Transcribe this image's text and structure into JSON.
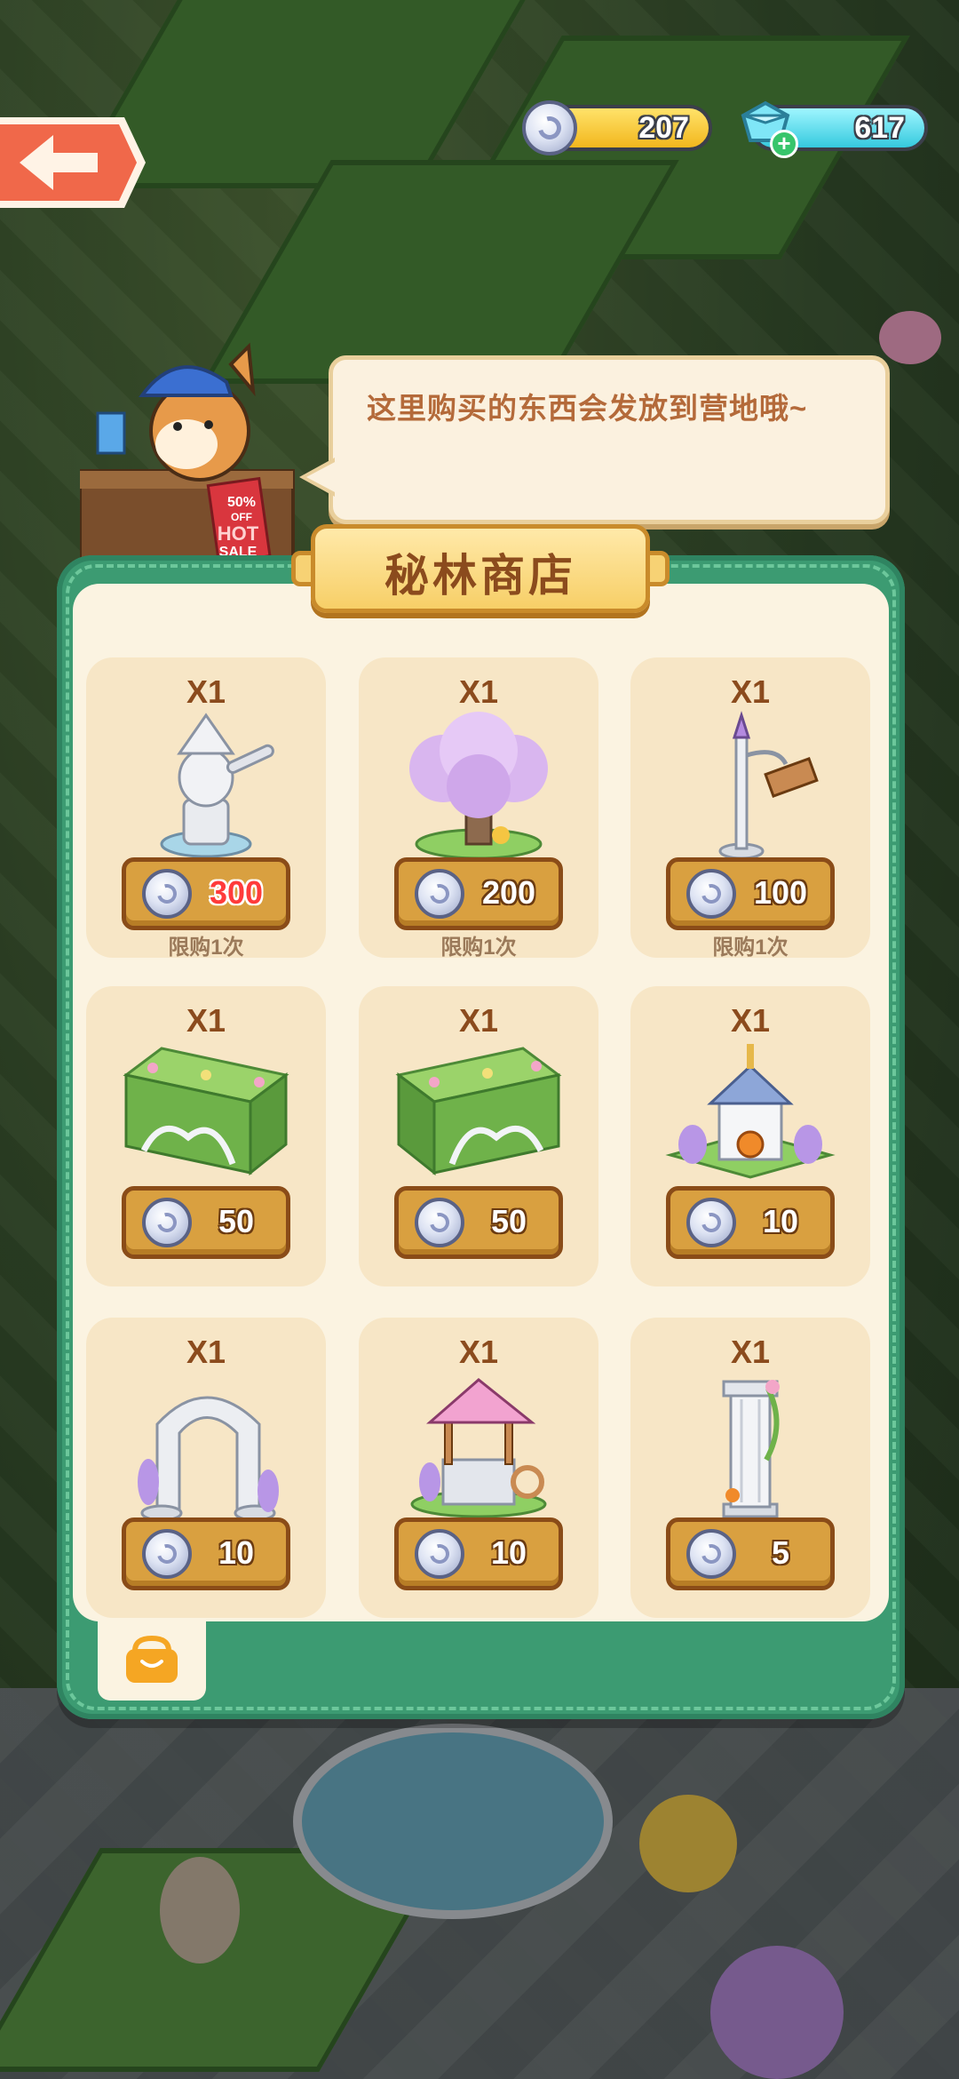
{
  "header": {
    "coins": "207",
    "gems": "617"
  },
  "npc": {
    "speech": "这里购买的东西会发放到营地哦~",
    "sign": {
      "discount": "50%",
      "off": "OFF",
      "hot": "HOT",
      "sale": "SALE"
    }
  },
  "shop": {
    "title": "秘林商店",
    "items": [
      {
        "qty": "X1",
        "price": "300",
        "limit": "限购1次",
        "icon": "statue-icon"
      },
      {
        "qty": "X1",
        "price": "200",
        "limit": "限购1次",
        "icon": "blossom-tree-icon"
      },
      {
        "qty": "X1",
        "price": "100",
        "limit": "限购1次",
        "icon": "signpost-lamp-icon"
      },
      {
        "qty": "X1",
        "price": "50",
        "limit": "",
        "icon": "hedge-fence-left-icon"
      },
      {
        "qty": "X1",
        "price": "50",
        "limit": "",
        "icon": "hedge-fence-right-icon"
      },
      {
        "qty": "X1",
        "price": "10",
        "limit": "",
        "icon": "gazebo-icon"
      },
      {
        "qty": "X1",
        "price": "10",
        "limit": "",
        "icon": "stone-arch-icon"
      },
      {
        "qty": "X1",
        "price": "10",
        "limit": "",
        "icon": "wishing-well-icon"
      },
      {
        "qty": "X1",
        "price": "5",
        "limit": "",
        "icon": "pillar-icon"
      }
    ]
  },
  "colors": {
    "panel": "#3c9b72",
    "card": "#f7e6c6",
    "price_button": "#d9a040",
    "highlight_price": "#ff3b3b"
  }
}
